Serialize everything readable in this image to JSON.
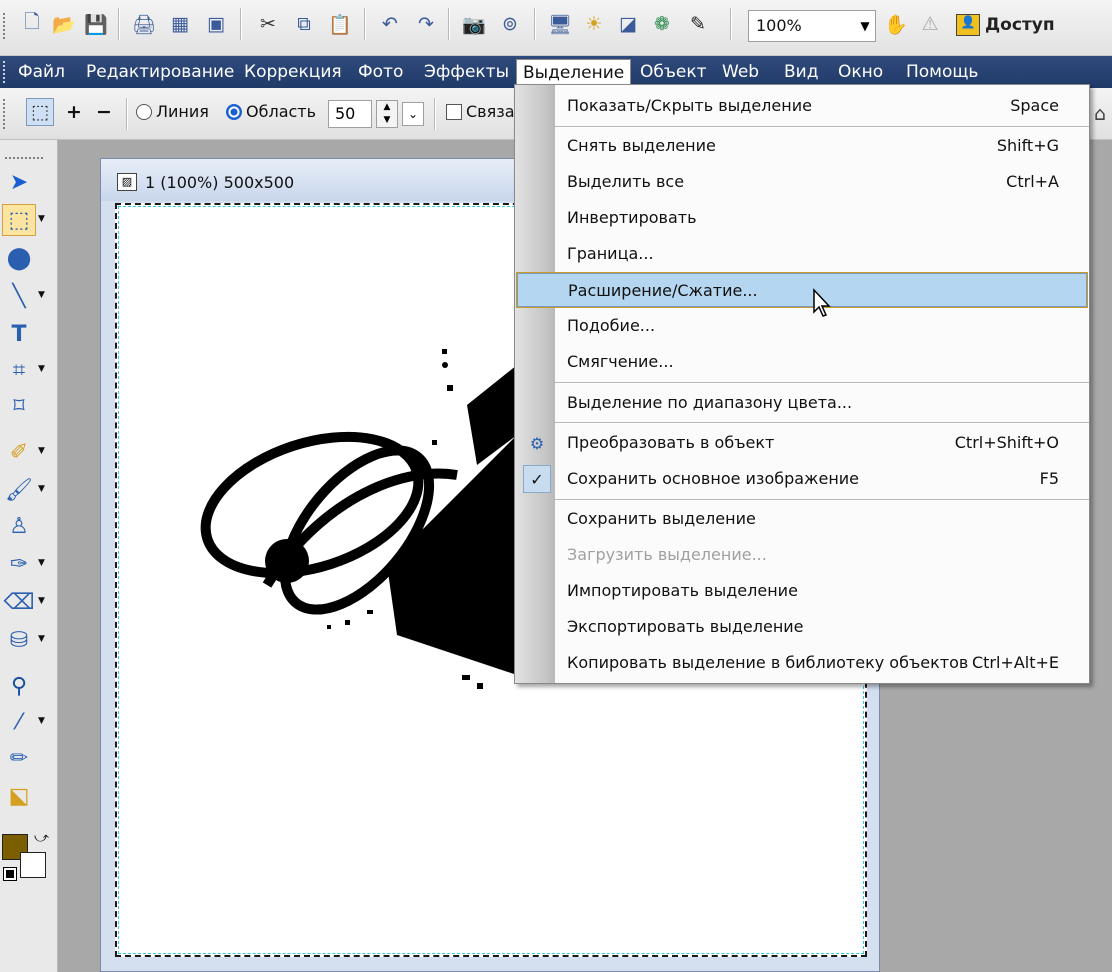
{
  "toolbar": {
    "zoom_value": "100%",
    "access_label": "Доступ"
  },
  "menubar": {
    "items": [
      "Файл",
      "Редактирование",
      "Коррекция",
      "Фото",
      "Эффекты",
      "Выделение",
      "Объект",
      "Web",
      "Вид",
      "Окно",
      "Помощь"
    ],
    "active_index": 5
  },
  "options": {
    "line_label": "Линия",
    "area_label": "Область",
    "size_value": "50",
    "link_label": "Связа"
  },
  "image_window": {
    "title": "1 (100%) 500x500"
  },
  "colors": {
    "menubar": "#203a68",
    "hover": "#b5d6f0",
    "foreground_swatch": "#7a5e00"
  },
  "dropdown": {
    "items": [
      {
        "label": "Показать/Скрыть выделение",
        "shortcut": "Space"
      },
      {
        "label": "Снять выделение",
        "shortcut": "Shift+G"
      },
      {
        "label": "Выделить все",
        "shortcut": "Ctrl+A"
      },
      {
        "label": "Инвертировать",
        "shortcut": ""
      },
      {
        "label": "Граница...",
        "shortcut": ""
      },
      {
        "label": "Расширение/Сжатие...",
        "shortcut": ""
      },
      {
        "label": "Подобие...",
        "shortcut": ""
      },
      {
        "label": "Смягчение...",
        "shortcut": ""
      },
      {
        "label": "Выделение по диапазону цвета...",
        "shortcut": ""
      },
      {
        "label": "Преобразовать  в объект",
        "shortcut": "Ctrl+Shift+O"
      },
      {
        "label": "Сохранить основное изображение",
        "shortcut": "F5"
      },
      {
        "label": "Сохранить выделение",
        "shortcut": ""
      },
      {
        "label": "Загрузить выделение...",
        "shortcut": ""
      },
      {
        "label": "Импортировать выделение",
        "shortcut": ""
      },
      {
        "label": "Экспортировать выделение",
        "shortcut": ""
      },
      {
        "label": "Копировать выделение в библиотеку объектов",
        "shortcut": "Ctrl+Alt+E"
      }
    ]
  }
}
